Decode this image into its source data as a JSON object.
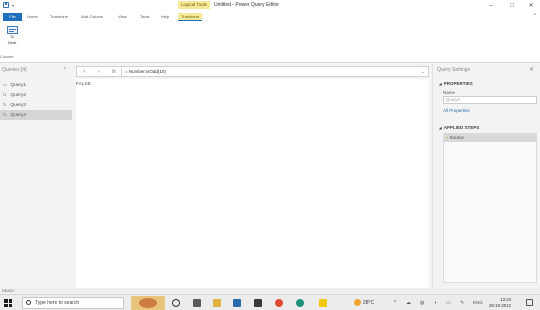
{
  "titlebar": {
    "context_tab": "Logical Tools",
    "title": "Untitled - Power Query Editor",
    "controls": [
      "–",
      "□",
      "✕"
    ]
  },
  "ribbon_tabs": {
    "file": "File",
    "home": "Home",
    "transform": "Transform",
    "add_column": "Add Column",
    "view": "View",
    "tools": "Tools",
    "help": "Help",
    "context_transform": "Transform"
  },
  "ribbon": {
    "to_table_label_1": "To",
    "to_table_label_2": "Table",
    "group_label": "Convert"
  },
  "queries": {
    "header": "Queries [4]",
    "items": [
      {
        "label": "Query1",
        "icon": "▭"
      },
      {
        "label": "Query2",
        "icon": "fx"
      },
      {
        "label": "Query3",
        "icon": "fx"
      },
      {
        "label": "Query4",
        "icon": "fx",
        "selected": true
      }
    ]
  },
  "formula_bar": {
    "cancel": "✕",
    "confirm": "✓",
    "fx": "fx",
    "formula": "= Number.IsOdd(10)"
  },
  "result": {
    "value": "FALSE"
  },
  "settings": {
    "title": "Query Settings",
    "properties_header": "PROPERTIES",
    "name_label": "Name",
    "name_value": "Query4",
    "all_properties": "All Properties",
    "applied_steps_header": "APPLIED STEPS",
    "steps": [
      "Source"
    ]
  },
  "status": {
    "text": "READY"
  },
  "taskbar": {
    "search_placeholder": "Type here to search",
    "weather": "28°C",
    "language": "ENG",
    "time": "13:34",
    "date": "28-10-2022"
  }
}
